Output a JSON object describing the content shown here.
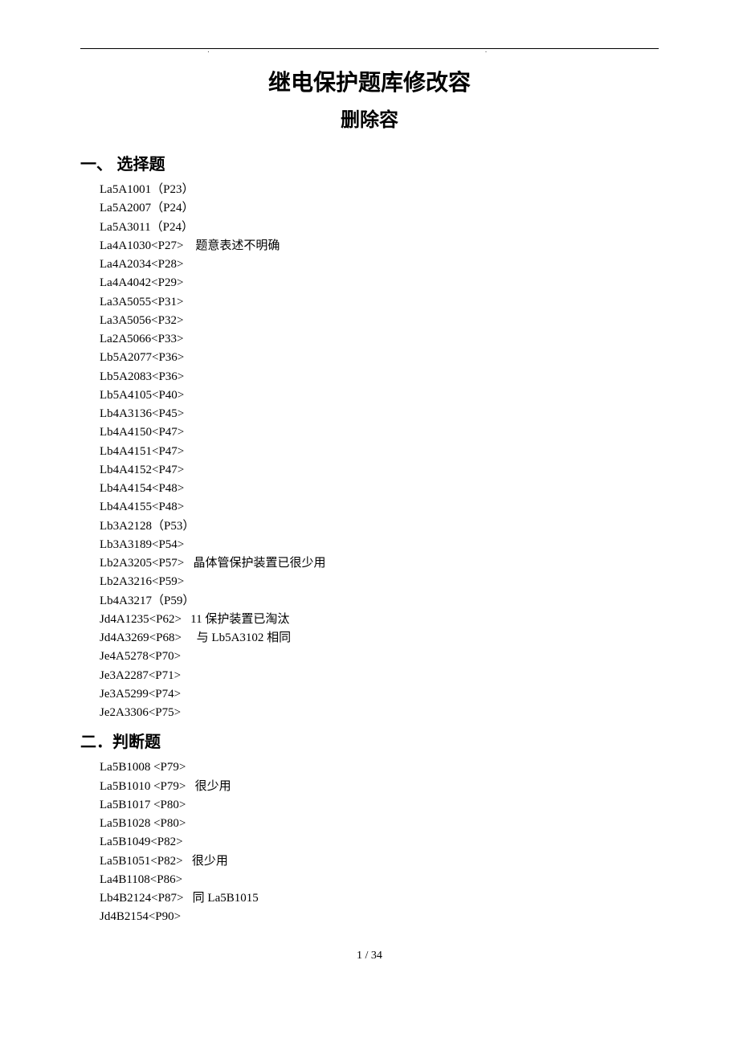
{
  "title": "继电保护题库修改容",
  "subtitle": "删除容",
  "sections": [
    {
      "heading": "一、 选择题",
      "items": [
        "La5A1001（P23）",
        "La5A2007（P24）",
        "La5A3011（P24）",
        "La4A1030<P27>    题意表述不明确",
        "La4A2034<P28>",
        "La4A4042<P29>",
        "La3A5055<P31>",
        "La3A5056<P32>",
        "La2A5066<P33>",
        "Lb5A2077<P36>",
        "Lb5A2083<P36>",
        "Lb5A4105<P40>",
        "Lb4A3136<P45>",
        "Lb4A4150<P47>",
        "Lb4A4151<P47>",
        "Lb4A4152<P47>",
        "Lb4A4154<P48>",
        "Lb4A4155<P48>",
        "Lb3A2128（P53）",
        "Lb3A3189<P54>",
        "Lb2A3205<P57>   晶体管保护装置已很少用",
        "Lb2A3216<P59>",
        "Lb4A3217（P59）",
        "Jd4A1235<P62>   11 保护装置已淘汰",
        "Jd4A3269<P68>     与 Lb5A3102 相同",
        "Je4A5278<P70>",
        "Je3A2287<P71>",
        "Je3A5299<P74>",
        "Je2A3306<P75>"
      ]
    },
    {
      "heading": "二．判断题",
      "items": [
        "La5B1008 <P79>",
        "La5B1010 <P79>   很少用",
        "La5B1017 <P80>",
        "La5B1028 <P80>",
        "La5B1049<P82>",
        "La5B1051<P82>   很少用",
        "La4B1108<P86>",
        "Lb4B2124<P87>   同 La5B1015",
        "Jd4B2154<P90>"
      ]
    }
  ],
  "footer": "1 / 34"
}
